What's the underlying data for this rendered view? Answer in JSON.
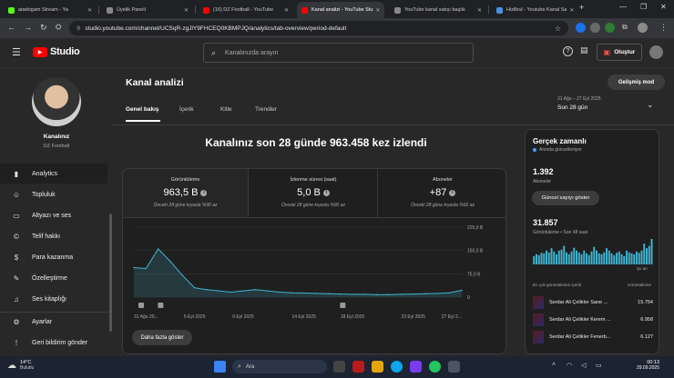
{
  "browser": {
    "tabs": [
      {
        "title": "atadogam Stream - Ya",
        "color": "#53fc18"
      },
      {
        "title": "Üyelik Paneli",
        "color": "#888888"
      },
      {
        "title": "(16) DZ Football - YouTube",
        "color": "#ff0000"
      },
      {
        "title": "Kanal analizi - YouTube Stu",
        "color": "#ff0000"
      },
      {
        "title": "YouTube kanal satışı başlık",
        "color": "#888888"
      },
      {
        "title": "Hizlibul - Youtube Kanal Sa",
        "color": "#4a90e2"
      }
    ],
    "new_tab": "+",
    "url": "studio.youtube.com/channel/UCSqR-zgJlY9FHCEQ0KBMPJQ/analytics/tab-overview/period-default"
  },
  "studio": {
    "logo_text": "Studio",
    "search_placeholder": "Kanalınızda arayın",
    "create_label": "Oluştur"
  },
  "sidebar": {
    "channel_label": "Kanalınız",
    "channel_name": "DZ Football",
    "items": [
      {
        "label": "Analytics",
        "icon": "analytics-icon",
        "glyph": "▮"
      },
      {
        "label": "Topluluk",
        "icon": "community-icon",
        "glyph": "☺"
      },
      {
        "label": "Altyazı ve ses",
        "icon": "subtitles-icon",
        "glyph": "▭"
      },
      {
        "label": "Telif hakkı",
        "icon": "copyright-icon",
        "glyph": "©"
      },
      {
        "label": "Para kazanma",
        "icon": "monetization-icon",
        "glyph": "$"
      },
      {
        "label": "Özelleştirme",
        "icon": "customization-icon",
        "glyph": "✎"
      },
      {
        "label": "Ses kitaplığı",
        "icon": "audio-library-icon",
        "glyph": "♫"
      },
      {
        "label": "Ayarlar",
        "icon": "settings-icon",
        "glyph": "⚙"
      },
      {
        "label": "Geri bildirim gönder",
        "icon": "feedback-icon",
        "glyph": "!"
      }
    ]
  },
  "page": {
    "title": "Kanal analizi",
    "advanced_mode": "Gelişmiş mod",
    "tabs": [
      "Genel bakış",
      "İçerik",
      "Kitle",
      "Trendler"
    ],
    "date_range": "31 Ağu – 27 Eyl 2025",
    "period": "Son 28 gün",
    "headline": "Kanalınız son 28 günde 963.458 kez izlendi",
    "stats": [
      {
        "label": "Görüntüleme",
        "value": "963,5 B",
        "sub": "Önceki 28 güne kıyasla %90 az"
      },
      {
        "label": "İzlenme süresi (saat)",
        "value": "5,0 B",
        "sub": "Önceki 28 güne kıyasla %90 az"
      },
      {
        "label": "Aboneler",
        "value": "+87",
        "sub": "Önceki 28 güne kıyasla %92 az"
      }
    ],
    "more_button": "Daha fazla göster"
  },
  "chart_data": {
    "type": "area",
    "x": [
      "31 Ağu",
      "1 Eyl",
      "2 Eyl",
      "3 Eyl",
      "4 Eyl",
      "5 Eyl",
      "6 Eyl",
      "7 Eyl",
      "8 Eyl",
      "9 Eyl",
      "10 Eyl",
      "11 Eyl",
      "12 Eyl",
      "13 Eyl",
      "14 Eyl",
      "15 Eyl",
      "16 Eyl",
      "17 Eyl",
      "18 Eyl",
      "19 Eyl",
      "20 Eyl",
      "21 Eyl",
      "22 Eyl",
      "23 Eyl",
      "24 Eyl",
      "25 Eyl",
      "26 Eyl",
      "27 Eyl"
    ],
    "series": [
      {
        "values": [
          95,
          92,
          155,
          115,
          70,
          30,
          24,
          20,
          16,
          20,
          24,
          20,
          16,
          14,
          13,
          12,
          11,
          10,
          9,
          9,
          8,
          8,
          9,
          10,
          11,
          12,
          14,
          22
        ]
      }
    ],
    "xticks": [
      "31 Ağu 20...",
      "5 Eyl 2025",
      "9 Eyl 2025",
      "14 Eyl 2025",
      "18 Eyl 2025",
      "23 Eyl 2025",
      "27 Eyl 2..."
    ],
    "xtick_index": [
      0,
      5,
      9,
      14,
      18,
      23,
      27
    ],
    "yticks": [
      "225,0 B",
      "150,0 B",
      "75,0 B",
      "0"
    ],
    "ylim": [
      0,
      225
    ],
    "color": "#41b4d2"
  },
  "realtime": {
    "title": "Gerçek zamanlı",
    "updating": "Anında güncelleniyor",
    "subscribers": "1.392",
    "subscribers_label": "Aboneler",
    "refresh_button": "Güncel sayıyı göster",
    "views": "31.857",
    "views_label": "Görüntüleme • Son 48 saat",
    "bars": [
      18,
      22,
      20,
      25,
      24,
      30,
      26,
      35,
      28,
      22,
      30,
      32,
      40,
      26,
      22,
      28,
      36,
      30,
      26,
      22,
      30,
      24,
      20,
      28,
      38,
      30,
      24,
      22,
      26,
      35,
      30,
      24,
      20,
      25,
      28,
      22,
      18,
      30,
      26,
      24,
      22,
      28,
      25,
      30,
      45,
      35,
      40,
      55
    ],
    "now_label": "Şu an",
    "top_content_label": "En çok görüntülenen içerik",
    "views_header": "Görüntüleme",
    "videos": [
      {
        "title": "Serdar Ali Çelikler Sane ...",
        "views": "15.754"
      },
      {
        "title": "Serdar Ali Çelikler Kerem ...",
        "views": "6.958"
      },
      {
        "title": "Serdar Ali Çelikler Fenerb...",
        "views": "6.127"
      }
    ]
  },
  "taskbar": {
    "weather_temp": "14°C",
    "weather_desc": "Bulutlu",
    "search": "Ara",
    "time": "00:13",
    "date": "29.09.2025"
  }
}
